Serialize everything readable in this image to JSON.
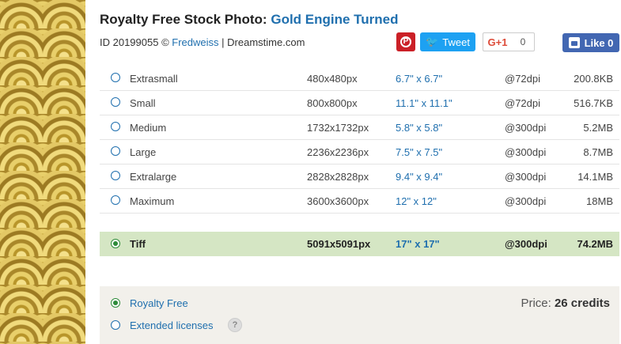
{
  "header": {
    "title_prefix": "Royalty Free Stock Photo:",
    "photo_name": "Gold Engine Turned",
    "id_text": "ID 20199055 ©",
    "author": "Fredweiss",
    "separator": "|",
    "site": "Dreamstime.com"
  },
  "social": {
    "pinterest_glyph": "P",
    "tweet_label": "Tweet",
    "gplus_label": "G+1",
    "gplus_count": "0",
    "like_label": "Like 0"
  },
  "sizes": [
    {
      "label": "Extrasmall",
      "px": "480x480px",
      "inches": "6.7\" x 6.7\"",
      "dpi": "@72dpi",
      "filesize": "200.8KB"
    },
    {
      "label": "Small",
      "px": "800x800px",
      "inches": "11.1\" x 11.1\"",
      "dpi": "@72dpi",
      "filesize": "516.7KB"
    },
    {
      "label": "Medium",
      "px": "1732x1732px",
      "inches": "5.8\" x 5.8\"",
      "dpi": "@300dpi",
      "filesize": "5.2MB"
    },
    {
      "label": "Large",
      "px": "2236x2236px",
      "inches": "7.5\" x 7.5\"",
      "dpi": "@300dpi",
      "filesize": "8.7MB"
    },
    {
      "label": "Extralarge",
      "px": "2828x2828px",
      "inches": "9.4\" x 9.4\"",
      "dpi": "@300dpi",
      "filesize": "14.1MB"
    },
    {
      "label": "Maximum",
      "px": "3600x3600px",
      "inches": "12\" x 12\"",
      "dpi": "@300dpi",
      "filesize": "18MB"
    }
  ],
  "tiff": {
    "label": "Tiff",
    "px": "5091x5091px",
    "inches": "17\" x 17\"",
    "dpi": "@300dpi",
    "filesize": "74.2MB",
    "selected": true
  },
  "licenses": {
    "royalty_free": "Royalty Free",
    "extended": "Extended licenses",
    "help_glyph": "?",
    "price_label": "Price:",
    "price_value": "26 credits"
  },
  "colors": {
    "link": "#1f6fae",
    "selected_row": "#d5e6c4",
    "license_bg": "#f2f0eb",
    "pinterest": "#cb2027",
    "twitter": "#1da1f2",
    "facebook": "#4267b2"
  }
}
